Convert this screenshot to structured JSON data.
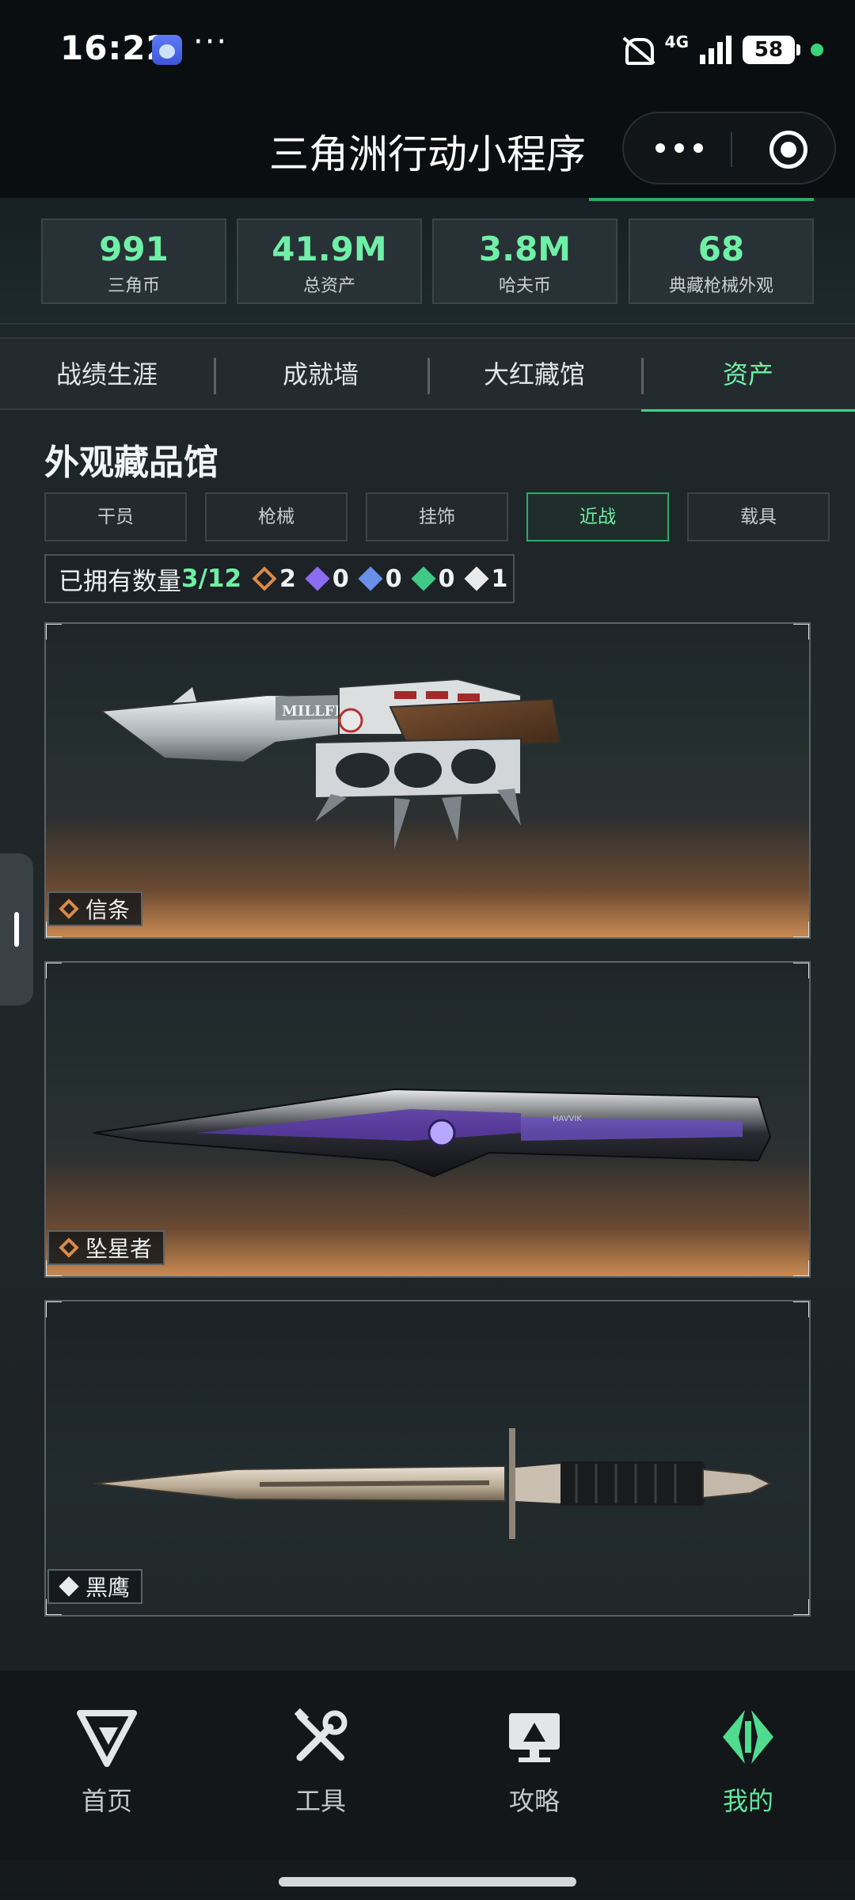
{
  "status_bar": {
    "time": "16:22",
    "dots": "···",
    "network": "4G",
    "battery": "58"
  },
  "title_bar": {
    "title": "三角洲行动小程序"
  },
  "stats": [
    {
      "value": "991",
      "label": "三角币"
    },
    {
      "value": "41.9M",
      "label": "总资产"
    },
    {
      "value": "3.8M",
      "label": "哈夫币"
    },
    {
      "value": "68",
      "label": "典藏枪械外观"
    }
  ],
  "tabs": [
    {
      "label": "战绩生涯",
      "active": false
    },
    {
      "label": "成就墙",
      "active": false
    },
    {
      "label": "大红藏馆",
      "active": false
    },
    {
      "label": "资产",
      "active": true
    }
  ],
  "section_title": "外观藏品馆",
  "categories": [
    {
      "label": "干员",
      "active": false
    },
    {
      "label": "枪械",
      "active": false
    },
    {
      "label": "挂饰",
      "active": false
    },
    {
      "label": "近战",
      "active": true
    },
    {
      "label": "载具",
      "active": false
    }
  ],
  "owned": {
    "label": "已拥有数量",
    "count": "3/12",
    "rarities": [
      {
        "name": "gold",
        "count": "2"
      },
      {
        "name": "purple",
        "count": "0"
      },
      {
        "name": "blue",
        "count": "0"
      },
      {
        "name": "green",
        "count": "0"
      },
      {
        "name": "white",
        "count": "1"
      }
    ]
  },
  "items": [
    {
      "name": "信条",
      "rarity": "gold",
      "engraving": "MILLFIELD"
    },
    {
      "name": "坠星者",
      "rarity": "gold",
      "engraving": "HAVVIK"
    },
    {
      "name": "黑鹰",
      "rarity": "white",
      "engraving": ""
    }
  ],
  "bottom_nav": [
    {
      "label": "首页",
      "icon": "delta-logo-icon",
      "active": false
    },
    {
      "label": "工具",
      "icon": "tools-icon",
      "active": false
    },
    {
      "label": "攻略",
      "icon": "guide-monitor-icon",
      "active": false
    },
    {
      "label": "我的",
      "icon": "profile-emblem-icon",
      "active": true
    }
  ],
  "colors": {
    "accent": "#6ff0a7",
    "gold": "#d98a4a",
    "background": "#1f2629"
  }
}
